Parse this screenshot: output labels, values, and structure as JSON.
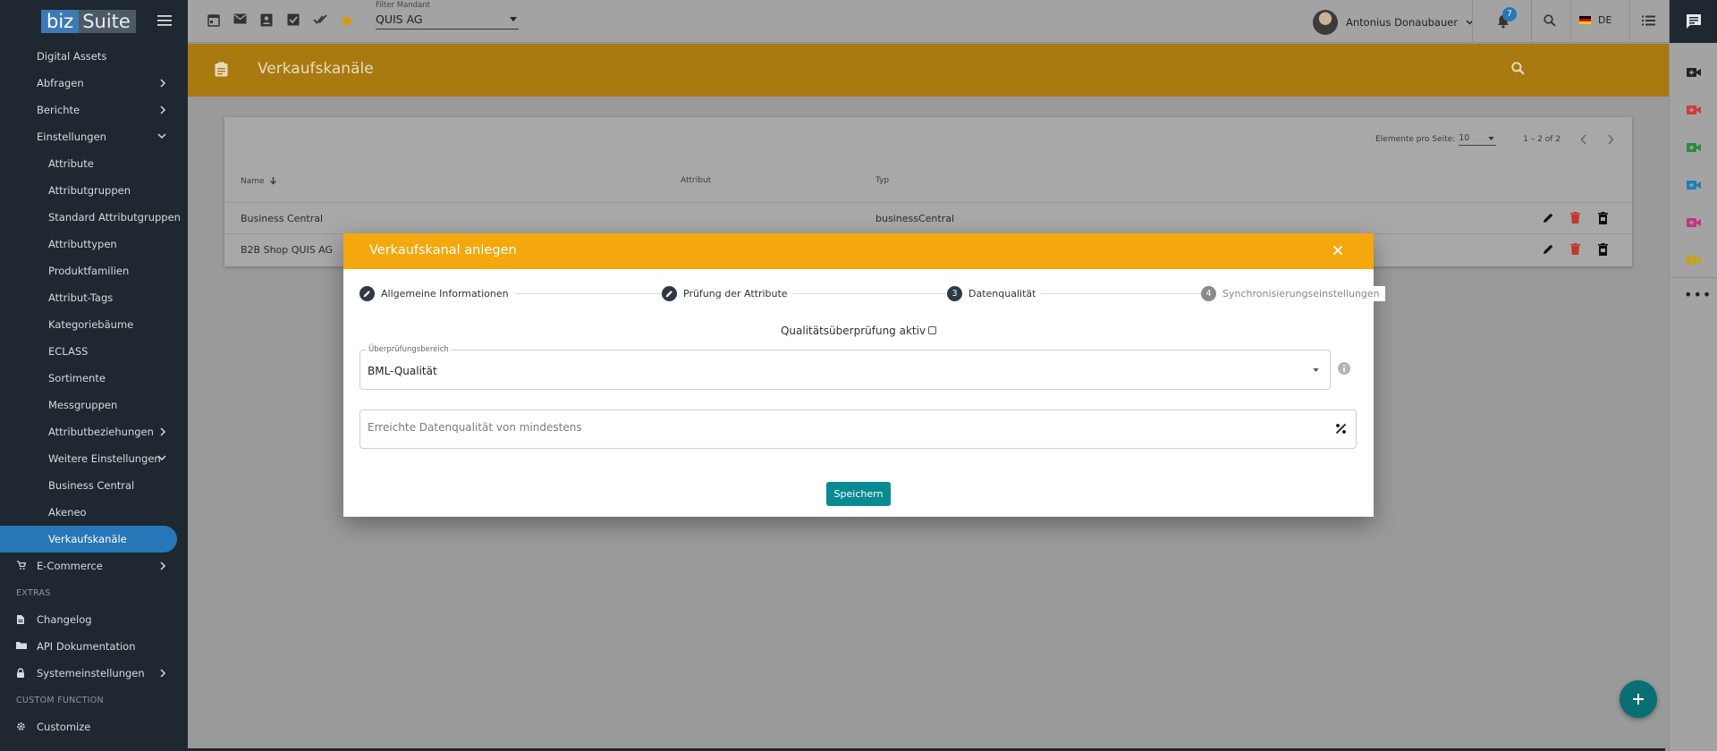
{
  "app": {
    "logo_a": "biz",
    "logo_b": "Suite"
  },
  "topbar": {
    "mandant_label": "Filter Mandant",
    "mandant_value": "QUIS AG",
    "user_name": "Antonius Donaubauer",
    "notification_count": "7",
    "language": "DE"
  },
  "sidebar": {
    "items": [
      {
        "label": "Digital Assets"
      },
      {
        "label": "Abfragen"
      },
      {
        "label": "Berichte"
      },
      {
        "label": "Einstellungen"
      },
      {
        "label": "Attribute"
      },
      {
        "label": "Attributgruppen"
      },
      {
        "label": "Standard Attributgruppen"
      },
      {
        "label": "Attributtypen"
      },
      {
        "label": "Produktfamilien"
      },
      {
        "label": "Attribut-Tags"
      },
      {
        "label": "Kategoriebäume"
      },
      {
        "label": "ECLASS"
      },
      {
        "label": "Sortimente"
      },
      {
        "label": "Messgruppen"
      },
      {
        "label": "Attributbeziehungen"
      },
      {
        "label": "Weitere Einstellungen"
      },
      {
        "label": "Business Central"
      },
      {
        "label": "Akeneo"
      },
      {
        "label": "Verkaufskanäle"
      },
      {
        "label": "E-Commerce"
      }
    ],
    "extras_header": "EXTRAS",
    "extras": [
      {
        "label": "Changelog"
      },
      {
        "label": "API Dokumentation"
      },
      {
        "label": "Systemeinstellungen"
      }
    ],
    "custom_header": "CUSTOM FUNCTION",
    "custom": [
      {
        "label": "Customize"
      }
    ]
  },
  "page": {
    "title": "Verkaufskanäle",
    "paginator": {
      "per_page_label": "Elemente pro Seite:",
      "per_page_value": "10",
      "range": "1 – 2 of 2"
    },
    "table": {
      "columns": [
        "Name",
        "Attribut",
        "Typ"
      ],
      "rows": [
        {
          "name": "Business Central",
          "attribut": "",
          "typ": "businessCentral"
        },
        {
          "name": "B2B Shop QUIS AG",
          "attribut": "",
          "typ": ""
        }
      ]
    }
  },
  "dialog": {
    "title": "Verkaufskanal anlegen",
    "steps": [
      {
        "num": "",
        "label": "Allgemeine Informationen",
        "state": "done"
      },
      {
        "num": "",
        "label": "Prüfung der Attribute",
        "state": "done"
      },
      {
        "num": "3",
        "label": "Datenqualität",
        "state": "active"
      },
      {
        "num": "4",
        "label": "Synchronisierungseinstellungen",
        "state": "todo"
      }
    ],
    "quality_check_label": "Qualitätsüberprüfung aktiv",
    "quality_check_checked": false,
    "scope_label": "Überprüfungsbereich",
    "scope_value": "BML-Qualität",
    "min_quality_placeholder": "Erreichte Datenqualität von mindestens",
    "min_quality_value": "",
    "save_label": "Speichern"
  },
  "colors": {
    "accent": "#f5a70e",
    "header_band": "#a87a10",
    "sidebar_bg": "#1f2730",
    "active_item": "#2677b8",
    "primary_button": "#0a8a92",
    "delete_icon": "#c0392b"
  }
}
